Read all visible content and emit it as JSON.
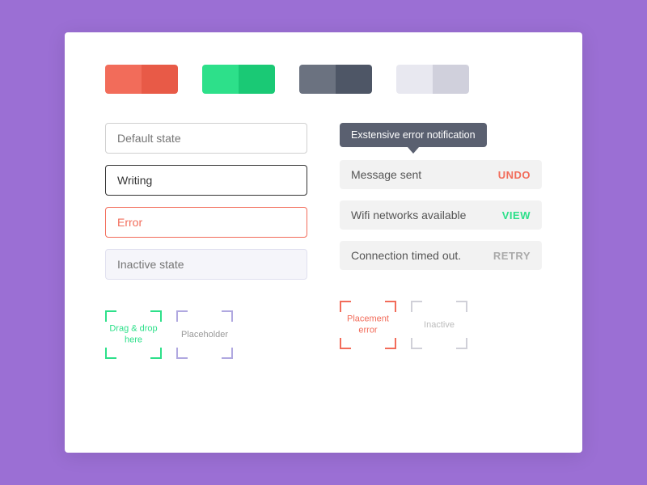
{
  "swatches": [
    {
      "left": "#f26c5a",
      "right": "#e85a47"
    },
    {
      "left": "#2de08a",
      "right": "#1ac975"
    },
    {
      "left": "#6b7280",
      "right": "#4e5666"
    },
    {
      "left": "#e8e8f0",
      "right": "#d0d0dc"
    }
  ],
  "inputs": {
    "default_placeholder": "Default state",
    "writing_value": "Writing|",
    "error_value": "Error",
    "inactive_placeholder": "Inactive state"
  },
  "tooltip": {
    "text": "Exstensive error notification"
  },
  "notif_bars": [
    {
      "label": "Message sent",
      "action": "UNDO",
      "action_class": "action-undo"
    },
    {
      "label": "Wifi networks available",
      "action": "VIEW",
      "action_class": "action-view"
    },
    {
      "label": "Connection timed out.",
      "action": "RETRY",
      "action_class": "action-retry"
    }
  ],
  "dropzones": {
    "left": [
      {
        "label": "Drag & drop\nhere",
        "style": "dz-green",
        "label_class": "dz-label-green"
      },
      {
        "label": "Placeholder",
        "style": "dz-purple",
        "label_class": "dz-label-purple"
      }
    ],
    "right": [
      {
        "label": "Placement\nerror",
        "style": "dz-red",
        "label_class": "dz-label-red"
      },
      {
        "label": "Inactive",
        "style": "dz-inactive",
        "label_class": "dz-label-inactive"
      }
    ]
  }
}
